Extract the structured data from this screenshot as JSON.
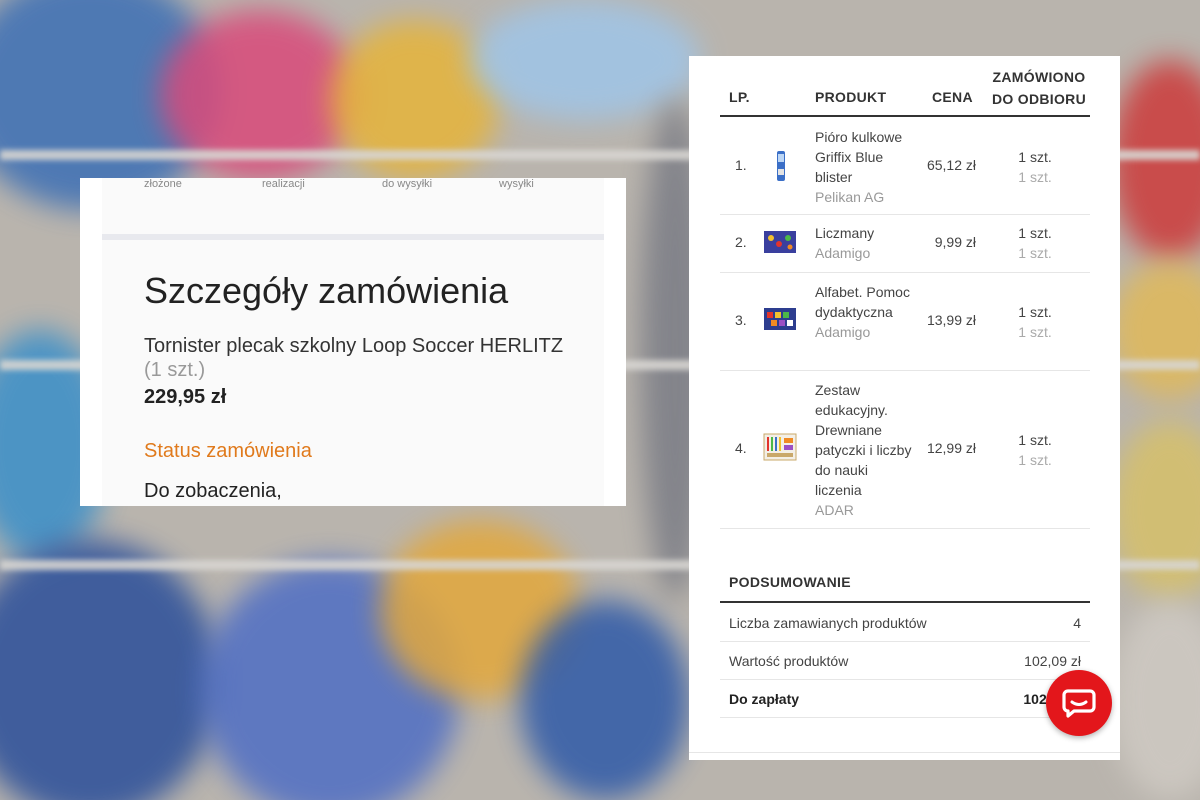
{
  "email": {
    "steps": [
      "złożone",
      "realizacji",
      "do wysyłki",
      "wysyłki"
    ],
    "title": "Szczegóły zamówienia",
    "product_name": "Tornister plecak szkolny Loop Soccer HERLITZ",
    "product_qty": "(1 szt.)",
    "product_price": "229,95 zł",
    "status_link": "Status zamówienia",
    "goodbye": "Do zobaczenia,"
  },
  "order_table": {
    "headers": {
      "lp": "LP.",
      "product": "PRODUKT",
      "price": "CENA",
      "ordered_line1": "ZAMÓWIONO",
      "ordered_line2": "DO ODBIORU"
    },
    "rows": [
      {
        "lp": "1.",
        "name": "Pióro kulkowe Griffix Blue blister",
        "brand": "Pelikan AG",
        "price": "65,12 zł",
        "ordered": "1 szt.",
        "pickup": "1 szt.",
        "thumb_icon": "pen-product-icon"
      },
      {
        "lp": "2.",
        "name": "Liczmany",
        "brand": "Adamigo",
        "price": "9,99 zł",
        "ordered": "1 szt.",
        "pickup": "1 szt.",
        "thumb_icon": "counters-box-icon"
      },
      {
        "lp": "3.",
        "name": "Alfabet. Pomoc dydaktyczna",
        "brand": "Adamigo",
        "price": "13,99 zł",
        "ordered": "1 szt.",
        "pickup": "1 szt.",
        "thumb_icon": "alphabet-box-icon"
      },
      {
        "lp": "4.",
        "name": "Zestaw edukacyjny. Drewniane patyczki i liczby do nauki liczenia",
        "brand": "ADAR",
        "price": "12,99 zł",
        "ordered": "1 szt.",
        "pickup": "1 szt.",
        "thumb_icon": "sticks-set-icon"
      }
    ],
    "summary": {
      "title": "PODSUMOWANIE",
      "count_label": "Liczba zamawianych produktów",
      "count_value": "4",
      "value_label": "Wartość produktów",
      "value_value": "102,09 zł",
      "total_label": "Do zapłaty",
      "total_value": "102,09 zł"
    }
  },
  "chat": {
    "icon": "chat-bubble-icon",
    "color": "#e3161b"
  },
  "colors": {
    "status_link": "#e07a1c",
    "accent_red": "#e3161b"
  }
}
